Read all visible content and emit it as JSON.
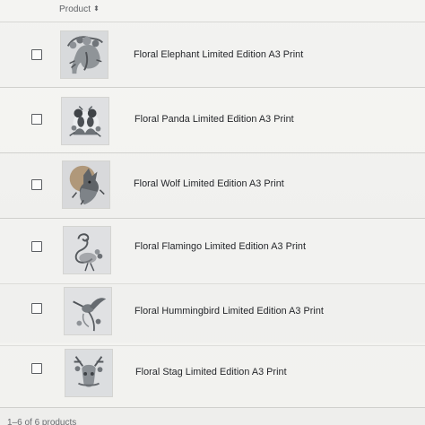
{
  "table": {
    "product_column_label": "Product",
    "sort_icon": "sort-arrows-icon",
    "rows": [
      {
        "title": "Floral Elephant Limited Edition A3 Print",
        "thumbnail_icon": "floral-elephant-thumbnail"
      },
      {
        "title": "Floral Panda Limited Edition A3 Print",
        "thumbnail_icon": "floral-panda-thumbnail"
      },
      {
        "title": "Floral Wolf Limited Edition A3 Print",
        "thumbnail_icon": "floral-wolf-thumbnail"
      },
      {
        "title": "Floral Flamingo Limited Edition A3 Print",
        "thumbnail_icon": "floral-flamingo-thumbnail"
      },
      {
        "title": "Floral Hummingbird Limited Edition A3 Print",
        "thumbnail_icon": "floral-hummingbird-thumbnail"
      },
      {
        "title": "Floral Stag Limited Edition A3 Print",
        "thumbnail_icon": "floral-stag-thumbnail"
      }
    ]
  },
  "footer": {
    "count_text": "1–6 of 6 products"
  },
  "colors": {
    "background": "#f1f1ef",
    "divider": "#d0d0cd",
    "text": "#24262a",
    "muted_text": "#5f6266"
  }
}
